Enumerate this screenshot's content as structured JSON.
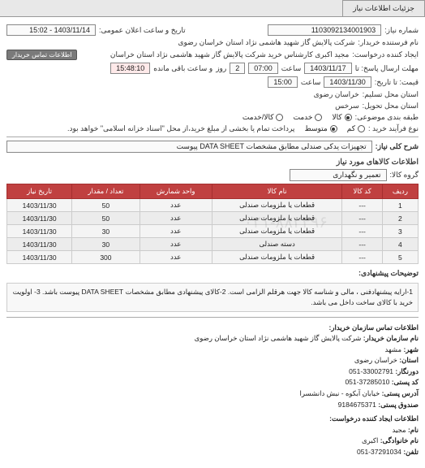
{
  "tabs": {
    "active": "جزئیات اطلاعات نیاز"
  },
  "header": {
    "req_no_label": "شماره نیاز:",
    "req_no": "1103092134001903",
    "announce_label": "تاریخ و ساعت اعلان عمومی:",
    "announce_value": "1403/11/14 - 15:02",
    "buyer_name_label": "نام فرستنده خریدار:",
    "buyer_name": "شرکت پالایش گاز شهید هاشمی نژاد   استان خراسان رضوی",
    "requester_label": "ایجاد کننده درخواست:",
    "requester": "مجید اکبری کارشناس خرید شرکت پالایش گاز شهید هاشمی نژاد   استان خراسان",
    "btn_contact": "اطلاعات تماس خریدار",
    "deadline_send_label": "مهلت ارسال پاسخ: تا",
    "deadline_date": "1403/11/17",
    "time_label": "ساعت",
    "deadline_time": "07:00",
    "days_label": "روز",
    "days_left": "2",
    "remain_label": "و ساعت باقی مانده",
    "remain_time": "15:48:10",
    "price_until_label": "قیمت: تا تاریخ:",
    "price_date": "1403/11/30",
    "price_time": "15:00",
    "loc_need_label": "استان محل تسلیم:",
    "loc_need": "خراسان رضوی",
    "loc_deliver_label": "استان محل تحویل:",
    "loc_deliver": "سرخس",
    "packaging_label": "طبقه بندی موضوعی:",
    "pkg_opts": {
      "goods": "کالا",
      "service": "خدمت",
      "both": "کالا/خدمت"
    },
    "payment_label": "نوع فرآیند خرید :",
    "pay_opts": {
      "low": "کم",
      "mid": "متوسط"
    },
    "payment_note": "پرداخت تمام یا بخشی از مبلغ خرید،از محل \"اسناد خزانه اسلامی\" خواهد بود."
  },
  "desc": {
    "label": "شرح کلی نیاز:",
    "value": "تجهیزات یدکی صندلی مطابق مشخصات DATA SHEET پیوست"
  },
  "goods_section": {
    "title": "اطلاعات کالاهای مورد نیاز",
    "group_label": "گروه کالا:",
    "group_value": "تعمیر و نگهداری"
  },
  "table": {
    "cols": {
      "row": "ردیف",
      "code": "کد کالا",
      "name": "نام کالا",
      "unit": "واحد شمارش",
      "qty": "تعداد / مقدار",
      "date": "تاریخ نیاز"
    },
    "rows": [
      {
        "n": "1",
        "code": "---",
        "name": "قطعات یا ملزومات صندلی",
        "unit": "عدد",
        "qty": "50",
        "date": "1403/11/30"
      },
      {
        "n": "2",
        "code": "---",
        "name": "قطعات یا ملزومات صندلی",
        "unit": "عدد",
        "qty": "50",
        "date": "1403/11/30"
      },
      {
        "n": "3",
        "code": "---",
        "name": "قطعات یا ملزومات صندلی",
        "unit": "عدد",
        "qty": "30",
        "date": "1403/11/30"
      },
      {
        "n": "4",
        "code": "---",
        "name": "دسته صندلی",
        "unit": "عدد",
        "qty": "30",
        "date": "1403/11/30"
      },
      {
        "n": "5",
        "code": "---",
        "name": "قطعات یا ملزومات صندلی",
        "unit": "عدد",
        "qty": "300",
        "date": "1403/11/30"
      }
    ]
  },
  "notes": {
    "label": "توضیحات پیشنهادی:",
    "text": "1-ارایه پیشنهادفنی ، مالی و شناسه کالا جهت هرقلم الزامی است. 2-کالای پیشنهادی مطابق مشخصات DATA SHEET پیوست باشد. 3- اولویت خرید با کالای ساخت داخل می باشد."
  },
  "buyer_org": {
    "title": "اطلاعات تماس سازمان خریدار:",
    "org_label": "نام سازمان خریدار:",
    "org": "شرکت پالایش گاز شهید هاشمی نژاد استان خراسان رضوی",
    "city_label": "شهر:",
    "city": "مشهد",
    "province_label": "استان:",
    "province": "خراسان رضوی",
    "fax_label": "دورنگار:",
    "fax": "33002791-051",
    "post_label": "کد پستی:",
    "post": "37285010-051",
    "addr_label": "آدرس پستی:",
    "addr": "خیابان آبکوه - نبش دانشسرا",
    "mailbox_label": "صندوق پستی:",
    "mailbox": "9184675371",
    "creator_title": "اطلاعات ایجاد کننده درخواست:",
    "name_label": "نام:",
    "name": "مجید",
    "family_label": "نام خانوادگی:",
    "family": "اکبری",
    "phone_label": "تلفن:",
    "phone": "37291034-051"
  },
  "watermark": "۰۲۱-۸۸۳۴۹۶"
}
